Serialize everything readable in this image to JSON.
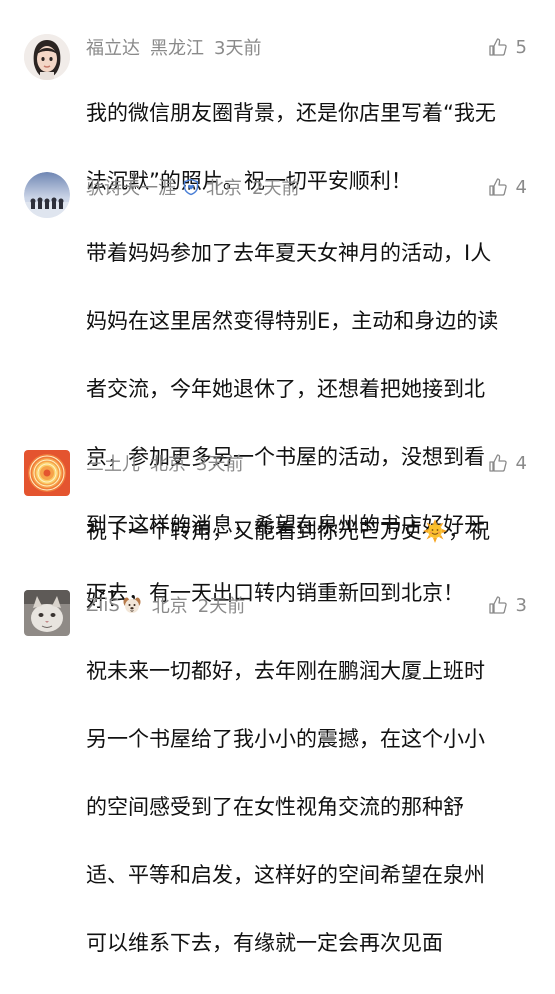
{
  "comments": [
    {
      "user": "福立达",
      "location": "黑龙江",
      "time": "3天前",
      "likes": "5",
      "text": "我的微信朋友圈背景，还是你店里写着“我无法沉默”的照片。祝一切平安顺利！",
      "lines": [
        "我的微信朋友圈背景，还是你店里写着“我无",
        "法沉默”的照片。祝一切平安顺利！"
      ]
    },
    {
      "user": "驮诗天一涯",
      "location": "北京",
      "time": "2天前",
      "likes": "4",
      "verified_icon": "shield-heart-icon",
      "lines": [
        "带着妈妈参加了去年夏天女神月的活动，I人",
        "妈妈在这里居然变得特别E，主动和身边的读",
        "者交流，今年她退休了，还想着把她接到北",
        "京，参加更多另一个书屋的活动，没想到看",
        "到了这样的消息，希望在泉州的书店好好开",
        "下去，有一天出口转内销重新回到北京！"
      ]
    },
    {
      "user": "三土儿",
      "location": "北京",
      "time": "3天前",
      "likes": "4",
      "emoji_icon": "sun-with-face-icon",
      "line1_before": "祝下一个转角，又能看到你光芒万丈",
      "line1_after": "，祝",
      "line2": "好！"
    },
    {
      "user": "ZiiS",
      "user_emoji_icon": "dog-face-icon",
      "location": "北京",
      "time": "2天前",
      "likes": "3",
      "lines": [
        "祝未来一切都好，去年刚在鹏润大厦上班时",
        "另一个书屋给了我小小的震撼，在这个小小",
        "的空间感受到了在女性视角交流的那种舒",
        "适、平等和启发，这样好的空间希望在泉州",
        "可以维系下去，有缘就一定会再次见面"
      ]
    }
  ],
  "colors": {
    "meta_text": "#8a8a8a",
    "body_text": "#111111",
    "verified_blue": "#4a7fd6"
  }
}
